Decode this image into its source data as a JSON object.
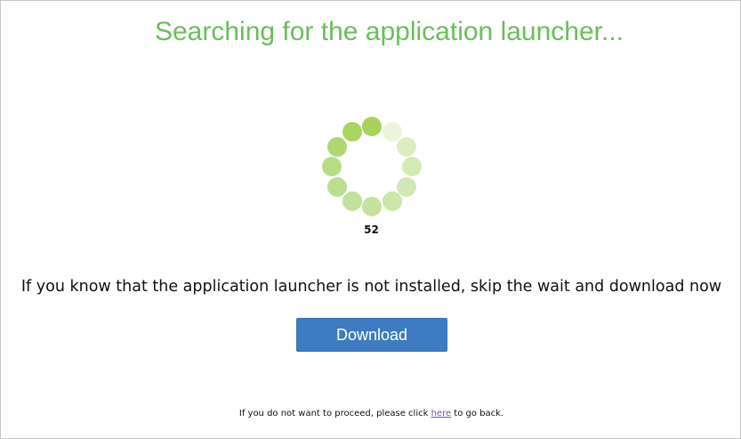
{
  "page": {
    "title": "Searching for the application launcher...",
    "counter": "52",
    "message": "If you know that the application launcher is not installed, skip the wait and download now",
    "download_label": "Download",
    "footer_before": "If you do not want to proceed, please click ",
    "footer_link": "here",
    "footer_after": " to go back."
  },
  "spinner": {
    "icon": "loading-spinner-icon",
    "dot_count": 12,
    "dot_colors": [
      "#a8d35a",
      "#ecf5dc",
      "#dcedc4",
      "#d6eab8",
      "#d2e8b4",
      "#cce6ac",
      "#c5e29e",
      "#c2e19a",
      "#bcde90",
      "#b7dc86",
      "#afd873",
      "#a9d563"
    ]
  },
  "colors": {
    "title": "#6abe5b",
    "button": "#3f7bc0",
    "link": "#7b4f9e"
  }
}
